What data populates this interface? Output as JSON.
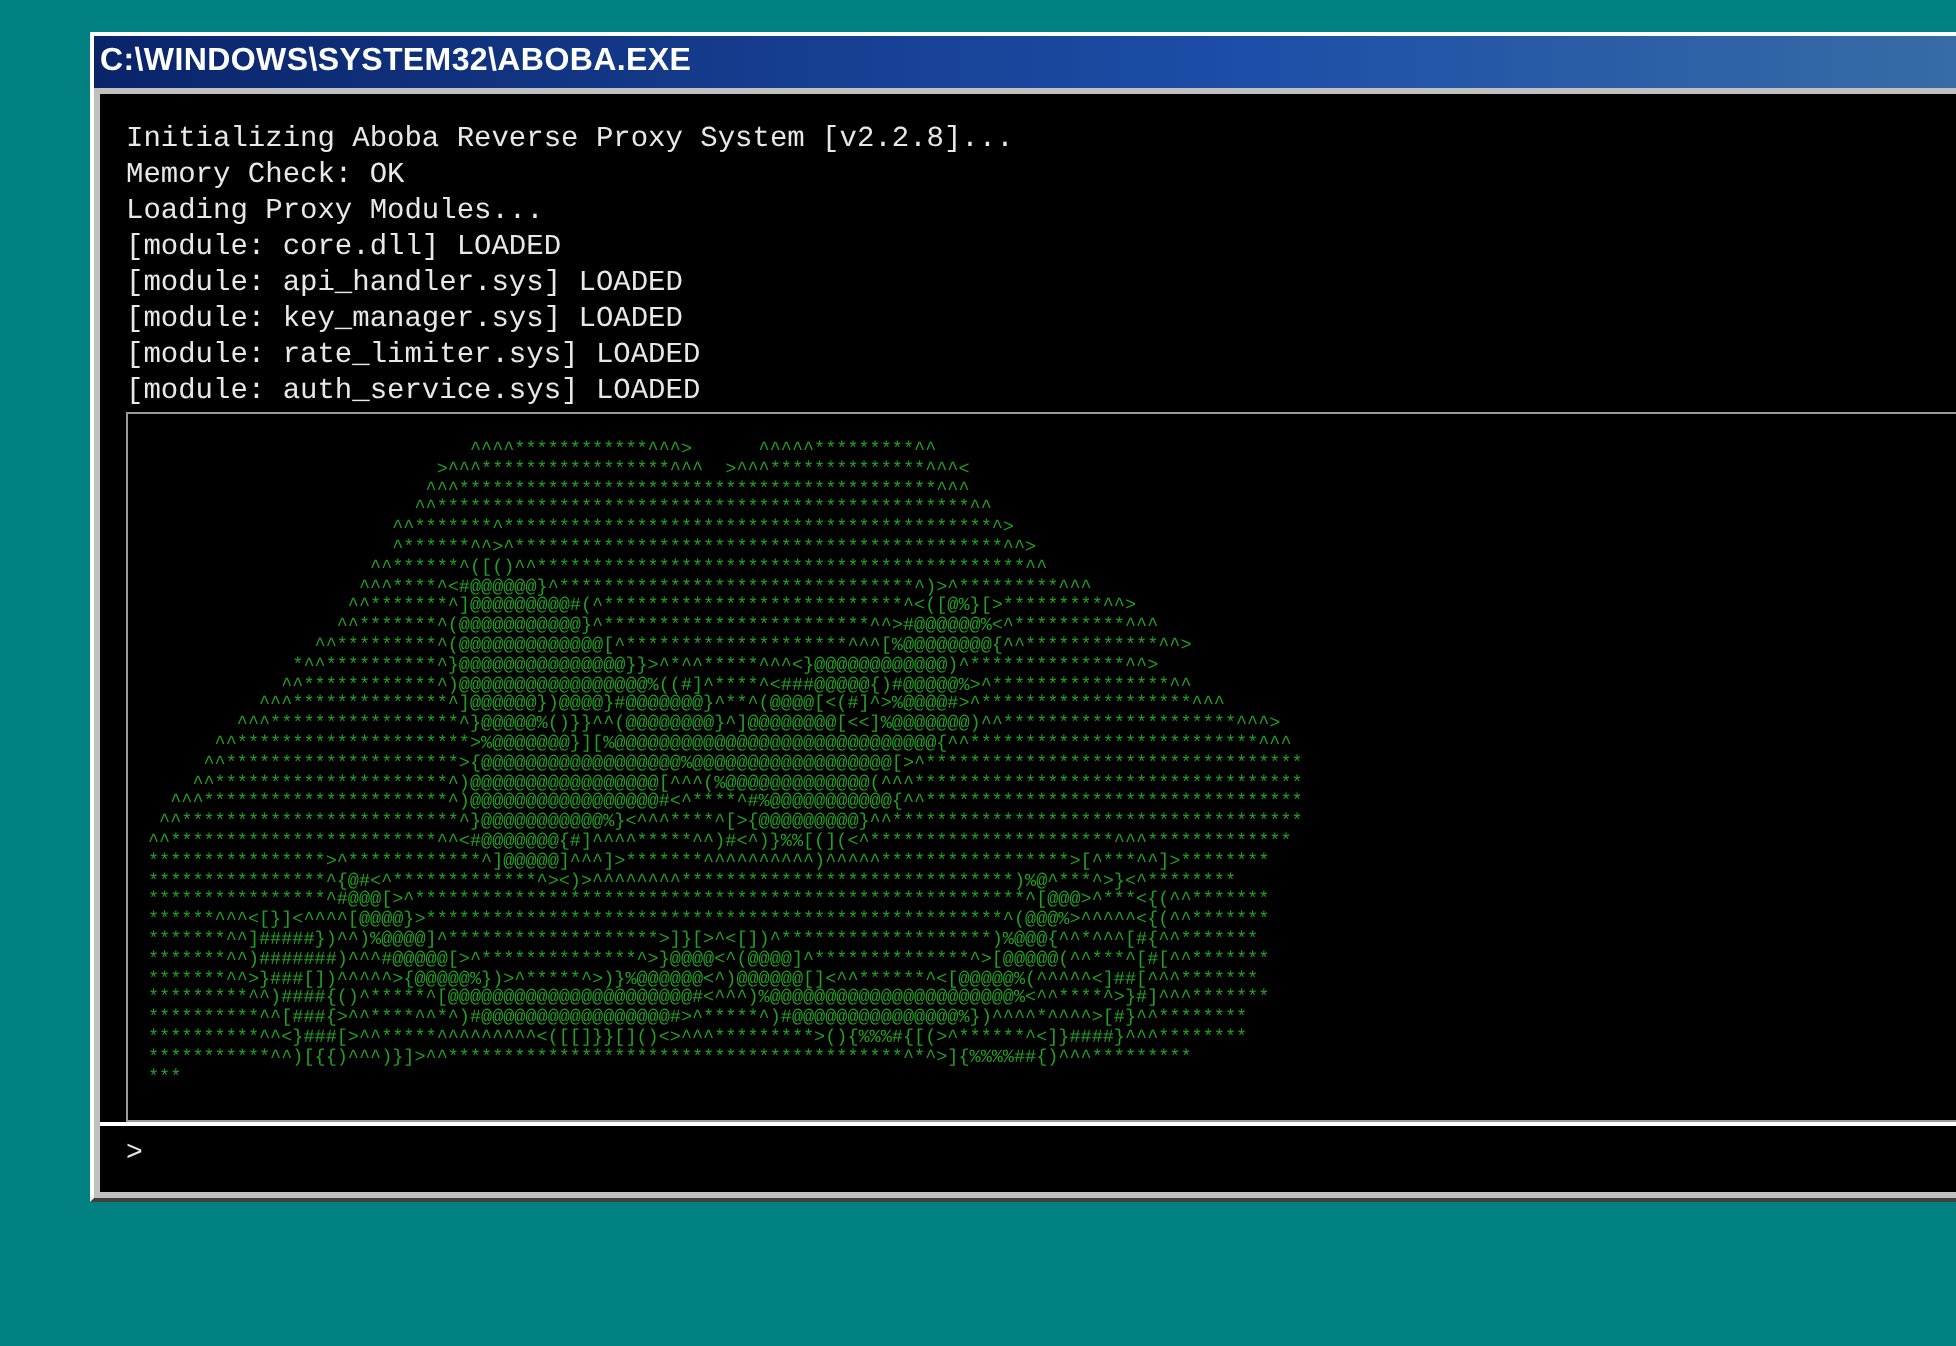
{
  "window": {
    "title": "C:\\WINDOWS\\SYSTEM32\\ABOBA.EXE"
  },
  "log_lines": [
    "Initializing Aboba Reverse Proxy System [v2.2.8]...",
    "Memory Check: OK",
    "Loading Proxy Modules...",
    "[module: core.dll] LOADED",
    "[module: api_handler.sys] LOADED",
    "[module: key_manager.sys] LOADED",
    "[module: rate_limiter.sys] LOADED",
    "[module: auth_service.sys] LOADED"
  ],
  "ascii_art": [
    "                             ^^^^************^^^>      ^^^^^*********^^",
    "                          >^^^*****************^^^  >^^^**************^^^<",
    "                         ^^^*******************************************^^^",
    "                        ^^************************************************^^",
    "                      ^^*******^********************************************^>",
    "                      ^******^^>^********************************************^^>",
    "                    ^^******^([()^^********************************************^^",
    "                   ^^^****^<#@@@@@@}^********************************^)>^*********^^^",
    "                  ^^*******^]@@@@@@@@@#(^***************************^<([@%}[>*********^^>",
    "                 ^^*******^(@@@@@@@@@@@}^************************^^>#@@@@@@%<^**********^^^",
    "               ^^*********^(@@@@@@@@@@@@@[^********************^^^[%@@@@@@@@{^^************^^>",
    "             *^^**********^}@@@@@@@@@@@@@@@}}>^*^^*****^^^<}@@@@@@@@@@@@)^**************^^>",
    "            ^^************^)@@@@@@@@@@@@@@@@@%((#]^****^<###@@@@@{)#@@@@@%>^****************^^",
    "          ^^^**************^]@@@@@@})@@@@}#@@@@@@@}^**^(@@@@[<(#]^>%@@@@#>^*******************^^^",
    "        ^^^*****************^}@@@@@%()}}^^(@@@@@@@@}^]@@@@@@@@[<<]%@@@@@@@)^^*********************^^^>",
    "      ^^*********************>%@@@@@@@}][%@@@@@@@@@@@@@@@@@@@@@@@@@@@@@{^^**************************^^^",
    "     ^^*********************>{@@@@@@@@@@@@@@@@@@%@@@@@@@@@@@@@@@@@@[>^**********************************",
    "    ^^*********************^)@@@@@@@@@@@@@@@@@[^^^(%@@@@@@@@@@@@@(^^^***********************************",
    "  ^^^**********************^)@@@@@@@@@@@@@@@@@#<^****^#%@@@@@@@@@@@{^^**********************************",
    " ^^*************************^}@@@@@@@@@@@%}<^^^****^[>{@@@@@@@@@}^^*************************************",
    "^^************************^^<#@@@@@@@{#]^^^^*****^^)#<^)}%%[(](<^**********************^^^*************",
    "****************>^************^]@@@@@]^^^]>*******^^^^^^^^^^)^^^^^*****************>[^***^^]>********",
    "****************^{@#<^*************^><)>^^^^^^^^******************************)%@^***^>}<^********",
    "****************^#@@@[>^*******************************************************^[@@@>^***<{(^^*******",
    "******^^^<[}]<^^^^[@@@@}>****************************************************^(@@@%>^^^^^<{(^^*******",
    "*******^^]#####})^^)%@@@@]^*******************>]}[>^<[])^*******************)%@@@{^^*^^^[#{^^*******",
    "*******^^)#######)^^^#@@@@@[>^**************^>}@@@@<^(@@@@]^**************^>[@@@@@(^^***^[#[^^*******",
    "*******^^>}###[])^^^^^>{@@@@@%})>^*****^>)}%@@@@@@<^)@@@@@@[]<^^******^<[@@@@@%(^^^^^<]##[^^^*******",
    "*********^^)####{()^*****^[@@@@@@@@@@@@@@@@@@@@@@#<^^^)%@@@@@@@@@@@@@@@@@@@@@@%<^^****^>}#]^^^*******",
    "**********^^[###{>^^****^^*^)#@@@@@@@@@@@@@@@@@#>^*****^)#@@@@@@@@@@@@@@@%})^^^^*^^^^>[#}^^********",
    "**********^^<}###[>^^*****^^^^^^^^^<([[]}}[]()<>^^^*********>(){%%%#{[(>^******^<]}####}^^^********",
    "***********^^)[{{)^^^)}]>^^*****************************************^*^>]{%%%%##{)^^^*********",
    "***"
  ],
  "prompt": ">"
}
